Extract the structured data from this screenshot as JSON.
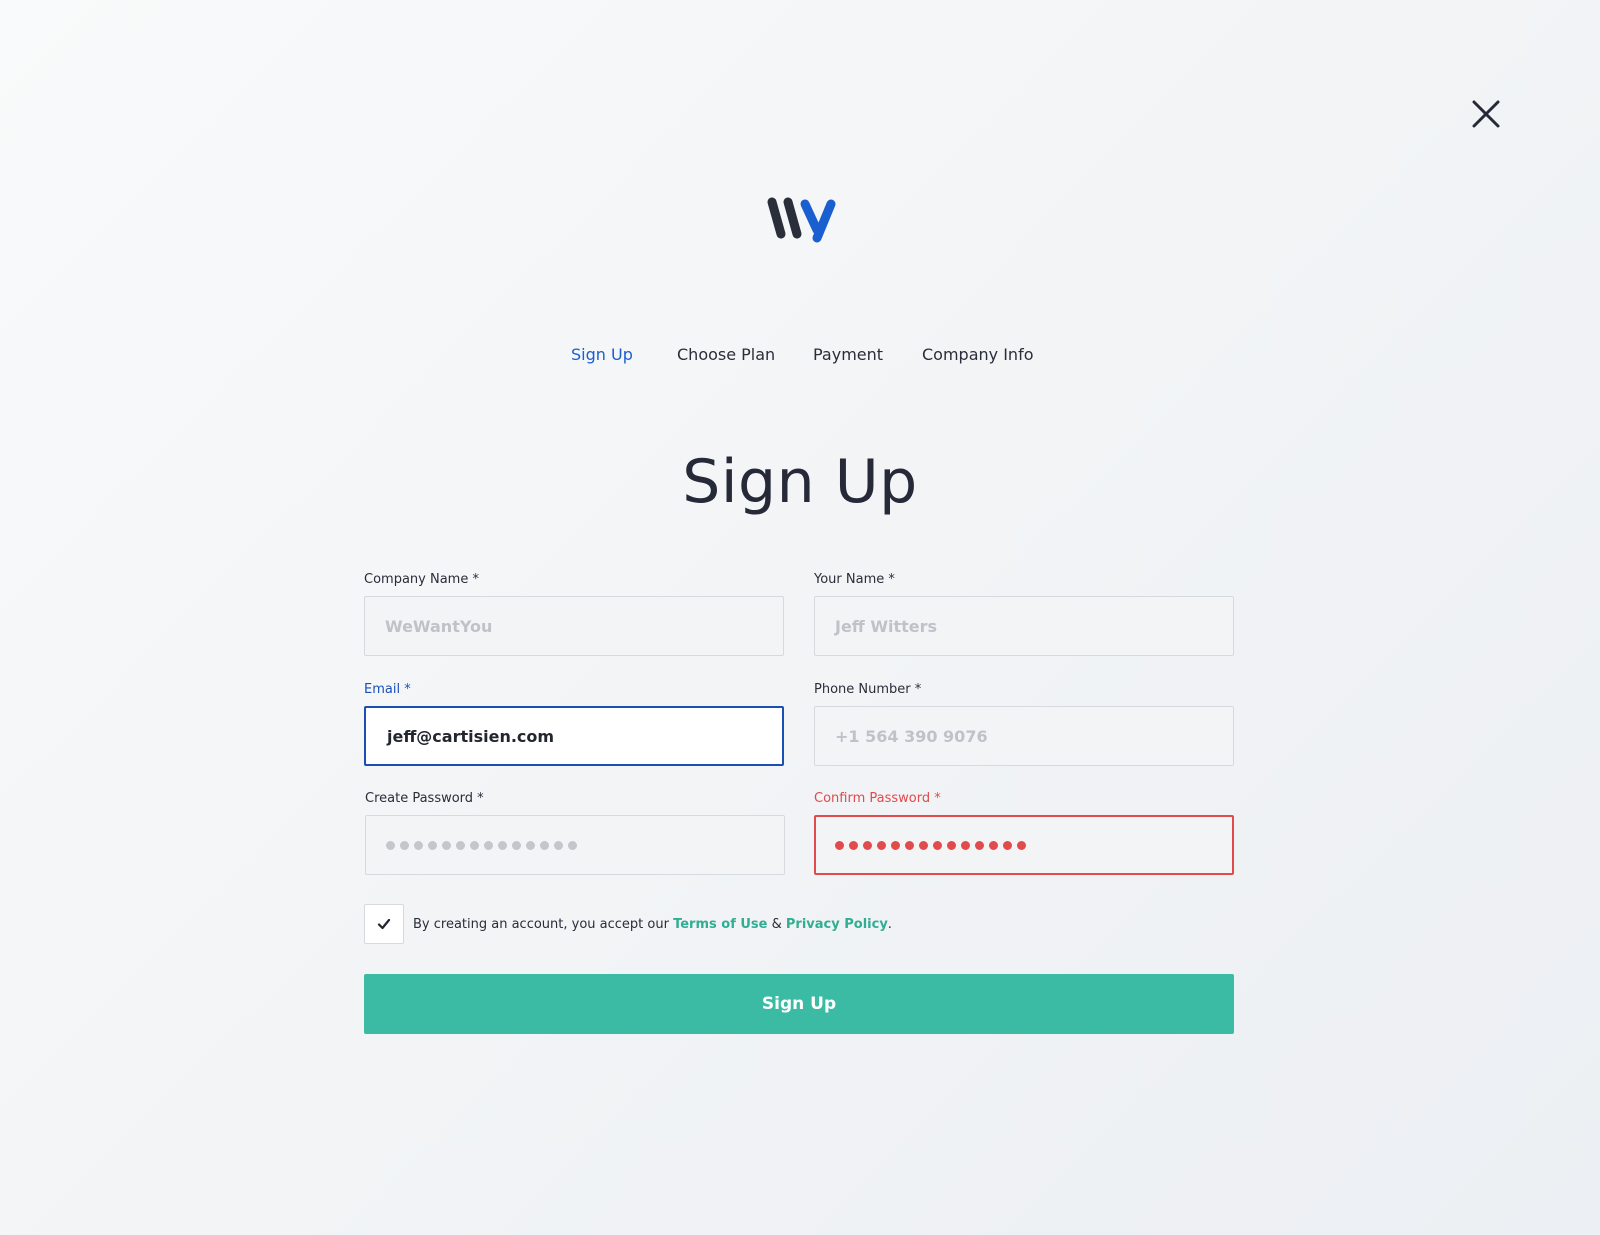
{
  "close_icon": "close-icon",
  "logo": {
    "icon": "wy-logo",
    "colors": [
      "#2a2d3a",
      "#1a5fd0"
    ]
  },
  "steps": [
    {
      "label": "Sign Up",
      "active": true
    },
    {
      "label": "Choose Plan",
      "active": false
    },
    {
      "label": "Payment",
      "active": false
    },
    {
      "label": "Company Info",
      "active": false
    }
  ],
  "title": "Sign Up",
  "form": {
    "company_name": {
      "label": "Company Name *",
      "placeholder": "WeWantYou"
    },
    "your_name": {
      "label": "Your Name *",
      "placeholder": "Jeff Witters"
    },
    "email": {
      "label": "Email *",
      "value": "jeff@cartisien.com",
      "state": "focused"
    },
    "phone": {
      "label": "Phone Number *",
      "placeholder": "+1 564 390 9076"
    },
    "create_password": {
      "label": "Create Password *",
      "masked_length": 14
    },
    "confirm_password": {
      "label": "Confirm Password *",
      "masked_length": 14,
      "state": "error"
    }
  },
  "terms": {
    "checked": true,
    "prefix": "By creating an account, you accept our ",
    "terms_link": "Terms of Use",
    "amp": " & ",
    "privacy_link": "Privacy Policy",
    "suffix": "."
  },
  "submit_label": "Sign Up",
  "colors": {
    "accent_blue": "#1a5fd0",
    "focus_blue": "#1a4fb5",
    "error_red": "#e14b4b",
    "brand_green": "#3bbba3"
  }
}
